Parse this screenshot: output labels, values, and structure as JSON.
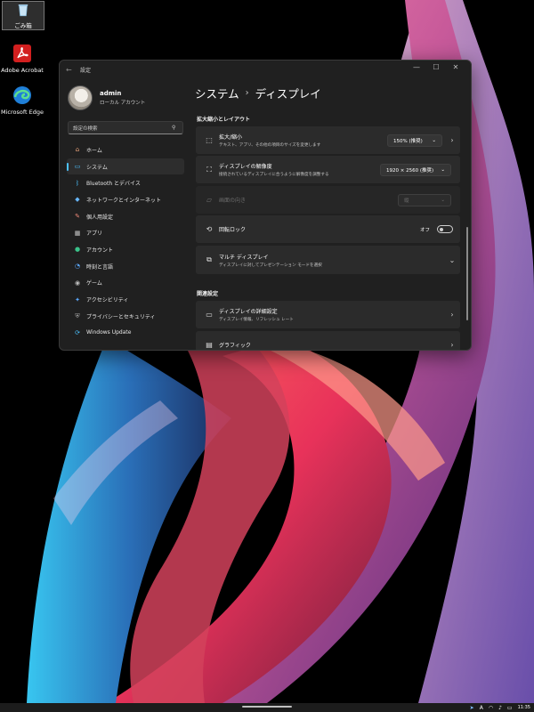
{
  "desktop": {
    "icons": [
      {
        "label": "ごみ箱",
        "icon": "recycle-bin-icon"
      },
      {
        "label": "Adobe Acrobat",
        "icon": "acrobat-icon"
      },
      {
        "label": "Microsoft Edge",
        "icon": "edge-icon"
      }
    ]
  },
  "window": {
    "title": "設定",
    "back_glyph": "←",
    "controls": {
      "minimize": "—",
      "maximize": "☐",
      "close": "✕"
    }
  },
  "profile": {
    "name": "admin",
    "account_type": "ローカル アカウント"
  },
  "search": {
    "placeholder": "設定の検索",
    "icon": "search-icon"
  },
  "nav": [
    {
      "label": "ホーム",
      "icon": "home-icon",
      "glyph": "⌂",
      "color": "#e8a27a"
    },
    {
      "label": "システム",
      "icon": "system-icon",
      "glyph": "▭",
      "color": "#4cc2ff",
      "active": true
    },
    {
      "label": "Bluetooth とデバイス",
      "icon": "bluetooth-icon",
      "glyph": "ᛒ",
      "color": "#4cc2ff"
    },
    {
      "label": "ネットワークとインターネット",
      "icon": "wifi-icon",
      "glyph": "◆",
      "color": "#67b7ff"
    },
    {
      "label": "個人用設定",
      "icon": "brush-icon",
      "glyph": "✎",
      "color": "#f08a7a"
    },
    {
      "label": "アプリ",
      "icon": "apps-icon",
      "glyph": "▦",
      "color": "#c7c7c7"
    },
    {
      "label": "アカウント",
      "icon": "account-icon",
      "glyph": "●",
      "color": "#3ac28a"
    },
    {
      "label": "時刻と言語",
      "icon": "time-language-icon",
      "glyph": "◔",
      "color": "#5aa8ff"
    },
    {
      "label": "ゲーム",
      "icon": "game-icon",
      "glyph": "◉",
      "color": "#bcbcbc"
    },
    {
      "label": "アクセシビリティ",
      "icon": "accessibility-icon",
      "glyph": "✦",
      "color": "#5aa8ff"
    },
    {
      "label": "プライバシーとセキュリティ",
      "icon": "shield-icon",
      "glyph": "⛨",
      "color": "#a9a9a9"
    },
    {
      "label": "Windows Update",
      "icon": "update-icon",
      "glyph": "⟳",
      "color": "#4cc2ff"
    }
  ],
  "breadcrumb": {
    "parent": "システム",
    "separator": "›",
    "current": "ディスプレイ"
  },
  "sections": {
    "scale_layout": "拡大縮小とレイアウト",
    "related": "関連設定"
  },
  "cards": {
    "scale": {
      "title": "拡大/縮小",
      "subtitle": "テキスト、アプリ、その他の項目のサイズを変更します",
      "value": "150% (推奨)",
      "icon": "scale-icon"
    },
    "resolution": {
      "title": "ディスプレイの解像度",
      "subtitle": "接続されているディスプレイに合うように解像度を調整する",
      "value": "1920 × 2560 (推奨)",
      "icon": "resolution-icon"
    },
    "orientation": {
      "title": "画面の向き",
      "value": "縦",
      "icon": "orientation-icon"
    },
    "rotation_lock": {
      "title": "回転ロック",
      "state": "オフ",
      "icon": "rotation-lock-icon"
    },
    "multi_display": {
      "title": "マルチ ディスプレイ",
      "subtitle": "ディスプレイに対してプレゼンテーション モードを選択",
      "icon": "multi-display-icon"
    },
    "advanced": {
      "title": "ディスプレイの詳細設定",
      "subtitle": "ディスプレイ情報、リフレッシュ レート",
      "icon": "monitor-icon"
    },
    "graphics": {
      "title": "グラフィック",
      "icon": "graphics-icon"
    }
  },
  "taskbar": {
    "clock": "11:35"
  }
}
